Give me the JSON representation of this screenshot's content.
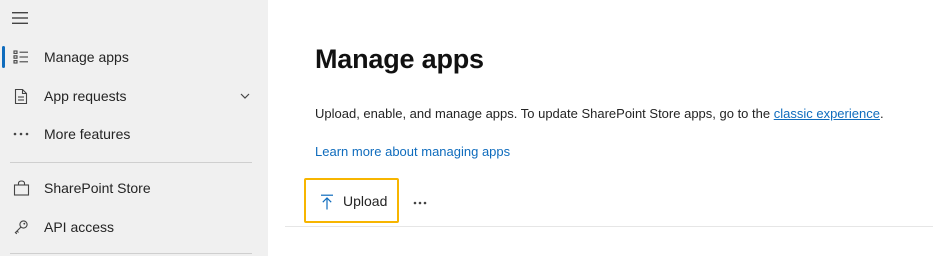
{
  "sidebar": {
    "items": [
      {
        "label": "Manage apps",
        "icon": "list-icon",
        "active": true
      },
      {
        "label": "App requests",
        "icon": "document-icon",
        "expandable": true
      },
      {
        "label": "More features",
        "icon": "ellipsis-icon"
      },
      {
        "label": "SharePoint Store",
        "icon": "shopping-bag-icon"
      },
      {
        "label": "API access",
        "icon": "key-icon"
      }
    ]
  },
  "main": {
    "title": "Manage apps",
    "description_prefix": "Upload, enable, and manage apps. To update SharePoint Store apps, go to the ",
    "description_link": "classic experience",
    "description_suffix": ".",
    "learn_more": "Learn more about managing apps",
    "toolbar": {
      "upload_label": "Upload",
      "more_label": "···"
    }
  },
  "colors": {
    "accent": "#0f6cbd",
    "highlight_border": "#f7b500",
    "sidebar_bg": "#f0f0f0"
  }
}
